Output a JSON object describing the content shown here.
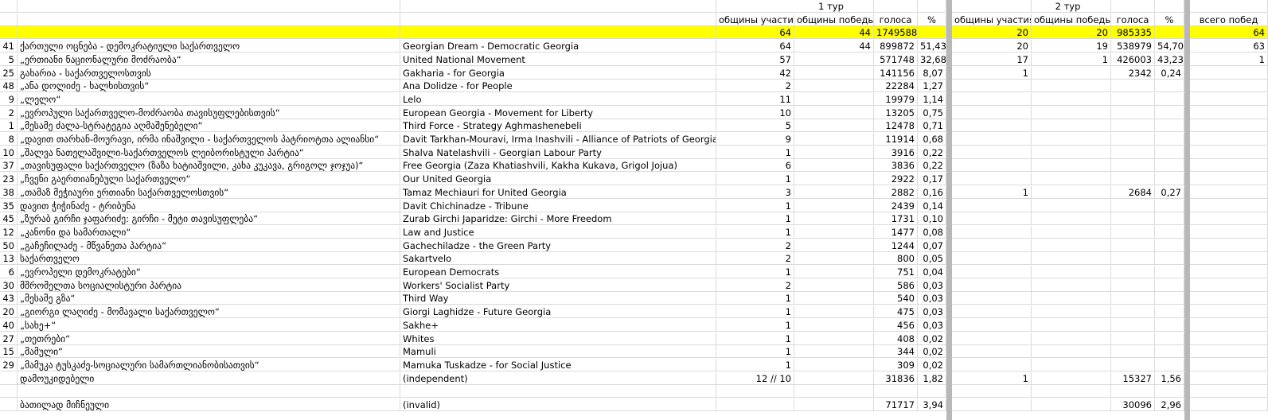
{
  "header": {
    "tour1_label": "1 тур",
    "tour2_label": "2 тур",
    "tour1": {
      "col_participation": "общины участия",
      "col_wins": "общины победы",
      "col_votes": "голоса",
      "col_pct": "%"
    },
    "tour2": {
      "col_participation": "общины участия",
      "col_wins": "общины победы",
      "col_votes": "голоса",
      "col_pct": "%"
    },
    "col_total_wins": "всего побед"
  },
  "totals": {
    "t1_part": "64",
    "t1_wins": "44",
    "t1_votes": "1749588",
    "t2_part": "20",
    "t2_wins": "20",
    "t2_votes": "985335",
    "total_wins": "64"
  },
  "rows": [
    {
      "n": "41",
      "ge": "ქართული ოცნება - დემოკრატიული საქართველო",
      "en": "Georgian Dream - Democratic Georgia",
      "t1p": "64",
      "t1w": "44",
      "t1v": "899872",
      "t1pct": "51,43",
      "t2p": "20",
      "t2w": "19",
      "t2v": "538979",
      "t2pct": "54,70",
      "tw": "63"
    },
    {
      "n": "5",
      "ge": "„ერთიანი ნაციონალური მოძრაობა“",
      "en": "United National Movement",
      "t1p": "57",
      "t1w": "",
      "t1v": "571748",
      "t1pct": "32,68",
      "t2p": "17",
      "t2w": "1",
      "t2v": "426003",
      "t2pct": "43,23",
      "tw": "1"
    },
    {
      "n": "25",
      "ge": "გახარია - საქართველოსთვის",
      "en": "Gakharia - for Georgia",
      "t1p": "42",
      "t1w": "",
      "t1v": "141156",
      "t1pct": "8,07",
      "t2p": "1",
      "t2w": "",
      "t2v": "2342",
      "t2pct": "0,24",
      "tw": ""
    },
    {
      "n": "48",
      "ge": "„ანა დოლიძე - ხალხისთვის“",
      "en": "Ana Dolidze - for People",
      "t1p": "2",
      "t1w": "",
      "t1v": "22284",
      "t1pct": "1,27",
      "t2p": "",
      "t2w": "",
      "t2v": "",
      "t2pct": "",
      "tw": ""
    },
    {
      "n": "9",
      "ge": "„ლელო“",
      "en": "Lelo",
      "t1p": "11",
      "t1w": "",
      "t1v": "19979",
      "t1pct": "1,14",
      "t2p": "",
      "t2w": "",
      "t2v": "",
      "t2pct": "",
      "tw": ""
    },
    {
      "n": "2",
      "ge": "„ევროპული საქართველო-მოძრაობა თავისუფლებისთვის“",
      "en": "European Georgia - Movement for Liberty",
      "t1p": "10",
      "t1w": "",
      "t1v": "13205",
      "t1pct": "0,75",
      "t2p": "",
      "t2w": "",
      "t2v": "",
      "t2pct": "",
      "tw": ""
    },
    {
      "n": "1",
      "ge": "„მესამე ძალა-სტრატეგია აღმაშენებელი“",
      "en": "Third Force - Strategy Aghmashenebeli",
      "t1p": "5",
      "t1w": "",
      "t1v": "12478",
      "t1pct": "0,71",
      "t2p": "",
      "t2w": "",
      "t2v": "",
      "t2pct": "",
      "tw": ""
    },
    {
      "n": "8",
      "ge": "„დავით თარხან-მოურავი, ირმა ინაშვილი - საქართველოს პატრიოტთა ალიანსი“",
      "en": "Davit Tarkhan-Mouravi, Irma Inashvili - Alliance of Patriots of Georgia",
      "t1p": "9",
      "t1w": "",
      "t1v": "11914",
      "t1pct": "0,68",
      "t2p": "",
      "t2w": "",
      "t2v": "",
      "t2pct": "",
      "tw": ""
    },
    {
      "n": "10",
      "ge": "„შალვა ნათელაშვილი-საქართველოს ლეიბორისტული პარტია“",
      "en": "Shalva Natelashvili - Georgian Labour Party",
      "t1p": "1",
      "t1w": "",
      "t1v": "3916",
      "t1pct": "0,22",
      "t2p": "",
      "t2w": "",
      "t2v": "",
      "t2pct": "",
      "tw": ""
    },
    {
      "n": "37",
      "ge": "„თავისუფალი საქართველო (ზაზა ხატიაშვილი, კახა კუკავა, გრიგოლ ჯოჯუა)“",
      "en": "Free Georgia (Zaza Khatiashvili, Kakha Kukava, Grigol Jojua)",
      "t1p": "6",
      "t1w": "",
      "t1v": "3836",
      "t1pct": "0,22",
      "t2p": "",
      "t2w": "",
      "t2v": "",
      "t2pct": "",
      "tw": ""
    },
    {
      "n": "23",
      "ge": "„ჩვენი გაერთიანებული საქართველო“",
      "en": "Our United Georgia",
      "t1p": "1",
      "t1w": "",
      "t1v": "2922",
      "t1pct": "0,17",
      "t2p": "",
      "t2w": "",
      "t2v": "",
      "t2pct": "",
      "tw": ""
    },
    {
      "n": "38",
      "ge": "„თამაზ მეჭიაური ერთიანი საქართველოსთვის“",
      "en": "Tamaz Mechiauri for United Georgia",
      "t1p": "3",
      "t1w": "",
      "t1v": "2882",
      "t1pct": "0,16",
      "t2p": "1",
      "t2w": "",
      "t2v": "2684",
      "t2pct": "0,27",
      "tw": ""
    },
    {
      "n": "35",
      "ge": "დავით ჭიჭინაძე - ტრიბუნა",
      "en": "Davit Chichinadze - Tribune",
      "t1p": "1",
      "t1w": "",
      "t1v": "2439",
      "t1pct": "0,14",
      "t2p": "",
      "t2w": "",
      "t2v": "",
      "t2pct": "",
      "tw": ""
    },
    {
      "n": "45",
      "ge": "„ზურაბ გირჩი ჯაფარიძე: გირჩი - მეტი თავისუფლება“",
      "en": "Zurab Girchi Japaridze: Girchi - More Freedom",
      "t1p": "1",
      "t1w": "",
      "t1v": "1731",
      "t1pct": "0,10",
      "t2p": "",
      "t2w": "",
      "t2v": "",
      "t2pct": "",
      "tw": ""
    },
    {
      "n": "12",
      "ge": "„კანონი და სამართალი“",
      "en": "Law and Justice",
      "t1p": "1",
      "t1w": "",
      "t1v": "1477",
      "t1pct": "0,08",
      "t2p": "",
      "t2w": "",
      "t2v": "",
      "t2pct": "",
      "tw": ""
    },
    {
      "n": "50",
      "ge": "„გაჩეჩილაძე - მწვანეთა პარტია“",
      "en": "Gachechiladze - the Green Party",
      "t1p": "2",
      "t1w": "",
      "t1v": "1244",
      "t1pct": "0,07",
      "t2p": "",
      "t2w": "",
      "t2v": "",
      "t2pct": "",
      "tw": ""
    },
    {
      "n": "13",
      "ge": "საქართველო",
      "en": "Sakartvelo",
      "t1p": "2",
      "t1w": "",
      "t1v": "800",
      "t1pct": "0,05",
      "t2p": "",
      "t2w": "",
      "t2v": "",
      "t2pct": "",
      "tw": ""
    },
    {
      "n": "6",
      "ge": "„ევროპელი დემოკრატები“",
      "en": "European Democrats",
      "t1p": "1",
      "t1w": "",
      "t1v": "751",
      "t1pct": "0,04",
      "t2p": "",
      "t2w": "",
      "t2v": "",
      "t2pct": "",
      "tw": ""
    },
    {
      "n": "30",
      "ge": "მშრომელთა სოციალისტური პარტია",
      "en": "Workers' Socialist Party",
      "t1p": "2",
      "t1w": "",
      "t1v": "586",
      "t1pct": "0,03",
      "t2p": "",
      "t2w": "",
      "t2v": "",
      "t2pct": "",
      "tw": ""
    },
    {
      "n": "43",
      "ge": "„მესამე გზა“",
      "en": "Third Way",
      "t1p": "1",
      "t1w": "",
      "t1v": "540",
      "t1pct": "0,03",
      "t2p": "",
      "t2w": "",
      "t2v": "",
      "t2pct": "",
      "tw": ""
    },
    {
      "n": "20",
      "ge": "„გიორგი ლაღიძე - მომავალი საქართველო“",
      "en": "Giorgi Laghidze - Future Georgia",
      "t1p": "1",
      "t1w": "",
      "t1v": "475",
      "t1pct": "0,03",
      "t2p": "",
      "t2w": "",
      "t2v": "",
      "t2pct": "",
      "tw": ""
    },
    {
      "n": "40",
      "ge": "„სახე+“",
      "en": "Sakhe+",
      "t1p": "1",
      "t1w": "",
      "t1v": "456",
      "t1pct": "0,03",
      "t2p": "",
      "t2w": "",
      "t2v": "",
      "t2pct": "",
      "tw": ""
    },
    {
      "n": "27",
      "ge": "„თეთრები“",
      "en": "Whites",
      "t1p": "1",
      "t1w": "",
      "t1v": "408",
      "t1pct": "0,02",
      "t2p": "",
      "t2w": "",
      "t2v": "",
      "t2pct": "",
      "tw": ""
    },
    {
      "n": "15",
      "ge": "„მამული“",
      "en": "Mamuli",
      "t1p": "1",
      "t1w": "",
      "t1v": "344",
      "t1pct": "0,02",
      "t2p": "",
      "t2w": "",
      "t2v": "",
      "t2pct": "",
      "tw": ""
    },
    {
      "n": "29",
      "ge": "„მამუკა ტუსკაძე-სოციალური სამართლიანობისათვის“",
      "en": "Mamuka Tuskadze - for Social Justice",
      "t1p": "1",
      "t1w": "",
      "t1v": "309",
      "t1pct": "0,02",
      "t2p": "",
      "t2w": "",
      "t2v": "",
      "t2pct": "",
      "tw": ""
    },
    {
      "n": "",
      "ge": "დამოუკიდებელი",
      "en": "(independent)",
      "t1p": "12 // 10",
      "t1w": "",
      "t1v": "31836",
      "t1pct": "1,82",
      "t2p": "1",
      "t2w": "",
      "t2v": "15327",
      "t2pct": "1,56",
      "tw": ""
    }
  ],
  "invalid": {
    "ge": "ბათილად მიჩნეული",
    "en": "(invalid)",
    "t1v": "71717",
    "t1pct": "3,94",
    "t2v": "30096",
    "t2pct": "2,96"
  }
}
